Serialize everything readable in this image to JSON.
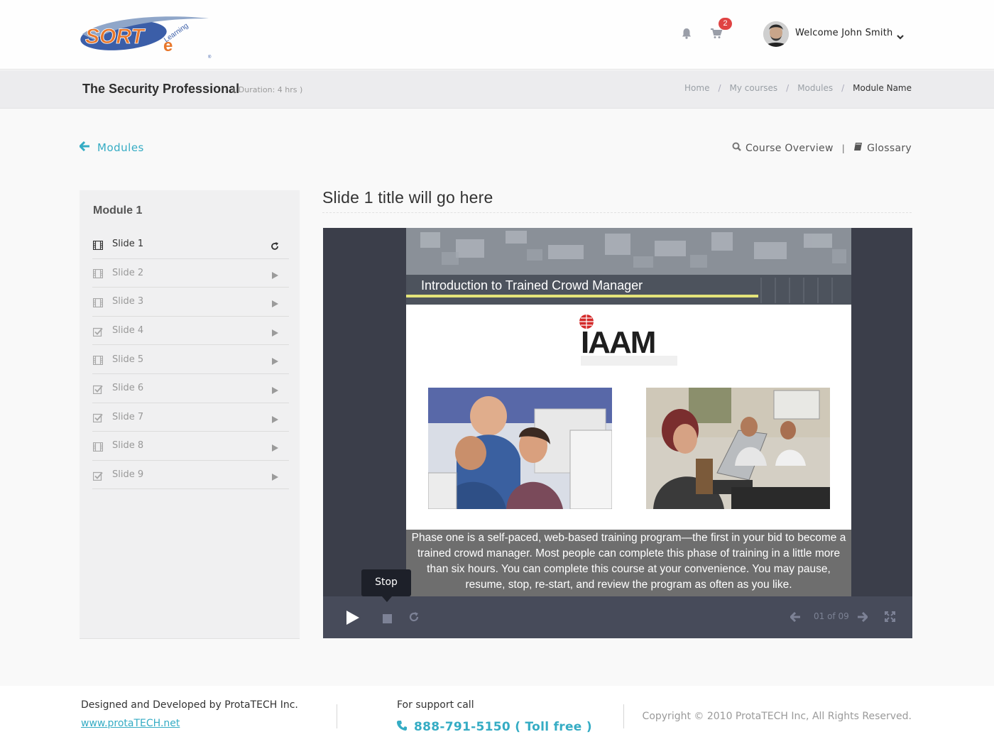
{
  "header": {
    "logo_wordmark": "SORT",
    "logo_sub": "Learning",
    "logo_e": "e",
    "logo_reg": "®",
    "cart_count": "2",
    "welcome_text": "Welcome John Smith"
  },
  "titlebar": {
    "course_title": "The Security Professional",
    "duration": "( Duration: 4 hrs )",
    "breadcrumb": [
      "Home",
      "My courses",
      "Modules",
      "Module Name"
    ],
    "separator": "/"
  },
  "nav": {
    "back_label": "Modules",
    "course_overview": "Course Overview",
    "pipe": "|",
    "glossary": "Glossary"
  },
  "sidebar": {
    "module_title": "Module 1",
    "slides": [
      {
        "label": "Slide 1",
        "icon": "film-icon",
        "action": "refresh-icon",
        "active": true
      },
      {
        "label": "Slide 2",
        "icon": "film-icon",
        "action": "play-icon",
        "active": false
      },
      {
        "label": "Slide 3",
        "icon": "film-icon",
        "action": "play-icon",
        "active": false
      },
      {
        "label": "Slide 4",
        "icon": "checkbox-icon",
        "action": "play-icon",
        "active": false
      },
      {
        "label": "Slide 5",
        "icon": "film-icon",
        "action": "play-icon",
        "active": false
      },
      {
        "label": "Slide 6",
        "icon": "checkbox-icon",
        "action": "play-icon",
        "active": false
      },
      {
        "label": "Slide 7",
        "icon": "checkbox-icon",
        "action": "play-icon",
        "active": false
      },
      {
        "label": "Slide 8",
        "icon": "film-icon",
        "action": "play-icon",
        "active": false
      },
      {
        "label": "Slide 9",
        "icon": "checkbox-icon",
        "action": "play-icon",
        "active": false
      }
    ]
  },
  "main": {
    "slide_title": "Slide 1  title will go here",
    "stage_heading": "Introduction to Trained Crowd Manager",
    "stage_logo_text": "IAAM",
    "caption": "Phase one is a self-paced, web-based training program—the first in your bid to become a trained crowd manager.  Most people can complete this phase of training in a little more than six hours.  You can complete this course at your convenience.  You may pause, resume, stop, re-start, and review the program as often as you like.",
    "tooltip": "Stop",
    "counter": "01 of 09"
  },
  "footer": {
    "designed_by": "Designed and Developed by ProtaTECH Inc.",
    "website": "www.protaTECH.net",
    "support_label": "For support call",
    "phone": "888-791-5150  ( Toll free )",
    "copyright": "Copyright © 2010 ProtaTECH Inc, All Rights Reserved."
  },
  "colors": {
    "accent": "#35acc4",
    "badge": "#e04343",
    "player_bg": "#3b3e4a",
    "controls_bg": "#474b5a"
  }
}
